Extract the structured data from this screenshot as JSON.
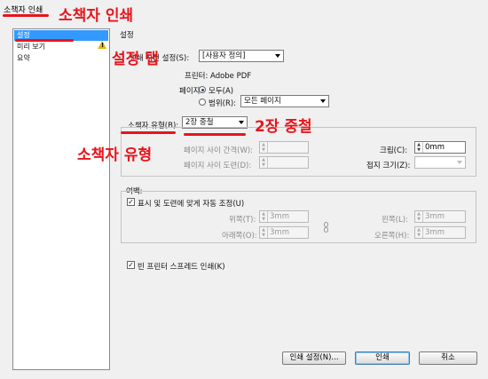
{
  "window": {
    "title": "소책자 인쇄"
  },
  "sidebar": {
    "items": [
      {
        "label": "설정",
        "selected": true
      },
      {
        "label": "미리 보기",
        "selected": false
      },
      {
        "label": "요약",
        "selected": false
      }
    ],
    "warning_icon": "warning-triangle-icon"
  },
  "settings": {
    "section_title": "설정",
    "preset_label": "인쇄 사전 설정(S):",
    "preset_value": "[사용자 정의]",
    "printer_label": "프린터: Adobe PDF",
    "pages_label": "페이지:",
    "pages_all_label": "모두(A)",
    "pages_range_label": "범위(R):",
    "pages_range_value": "모든 페이지",
    "pages_selected": "all"
  },
  "booklet": {
    "type_label": "소책자 유형(B):",
    "type_value": "2장 중철",
    "space_between_label": "페이지 사이 간격(W):",
    "bleed_between_label": "페이지 사이 도련(D):",
    "creep_label": "크립(C):",
    "creep_value": "0mm",
    "signature_label": "접지 크기(Z):",
    "signature_value": ""
  },
  "margins": {
    "group_label": "여백:",
    "auto_adjust_label": "표시 및 도련에 맞게 자동 조정(U)",
    "auto_adjust_checked": true,
    "top_label": "위쪽(T):",
    "top_value": "3mm",
    "bottom_label": "아래쪽(O):",
    "bottom_value": "3mm",
    "left_label": "왼쪽(L):",
    "left_value": "3mm",
    "right_label": "오른쪽(H):",
    "right_value": "3mm",
    "link_icon": "chain-link-icon"
  },
  "blank_spreads": {
    "label": "빈 프린터 스프레드 인쇄(K)",
    "checked": true
  },
  "buttons": {
    "print_setup": "인쇄 설정(N)...",
    "print": "인쇄",
    "cancel": "취소"
  },
  "annotations": {
    "title_note": "소책자 인쇄",
    "tab_note": "설정 탭",
    "type_value_note": "2장 중철",
    "type_label_note": "소책자 유형",
    "color": "#e8141c"
  }
}
